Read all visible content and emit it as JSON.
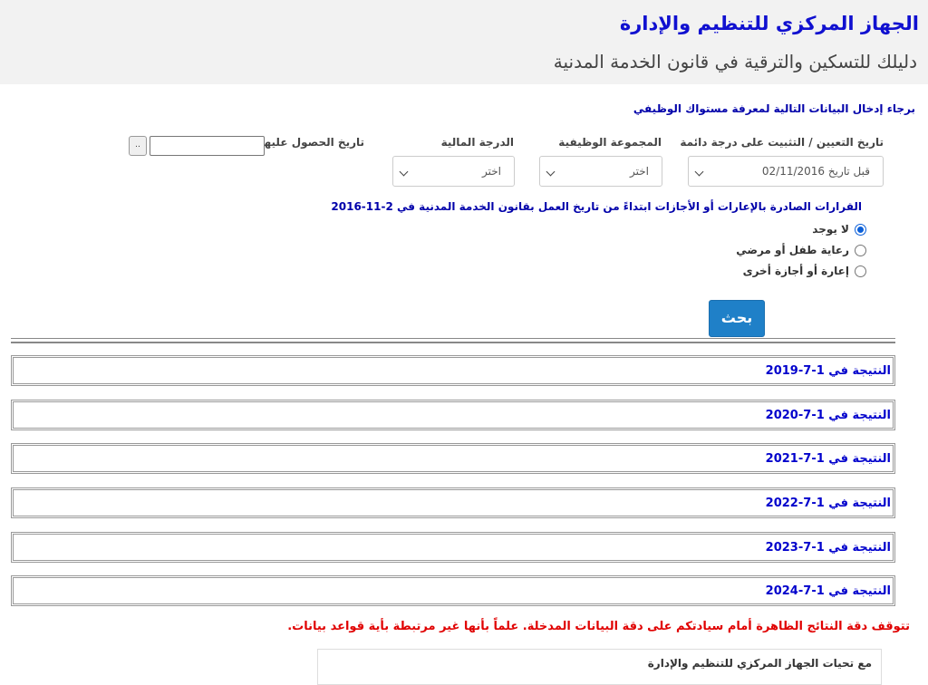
{
  "header": {
    "org_title": "الجهاز المركزي للتنظيم والإدارة",
    "guide_title": "دليلك للتسكين والترقية في قانون الخدمة المدنية"
  },
  "form": {
    "instructions": "برجاء إدخال البيانات التالية لمعرفة مستواك الوظيفي",
    "appointment_label": "تاريخ التعيين / التثبيت على درجة دائمة",
    "appointment_value": "قبل تاريخ 02/11/2016",
    "group_label": "المجموعة الوظيفية",
    "group_value": "اختر",
    "grade_label": "الدرجة المالية",
    "grade_value": "اختر",
    "obtained_label": "تاريخ الحصول عليها",
    "obtained_value": "",
    "dots_label": ".."
  },
  "decisions": {
    "title": "القرارات الصادرة بالإعارات أو الأجازات ابتداءً من تاريخ العمل بقانون الخدمة المدنية في 2-11-2016",
    "options": [
      {
        "label": "لا يوجد",
        "checked": true
      },
      {
        "label": "رعاية طفل أو مرضي",
        "checked": false
      },
      {
        "label": "إعارة أو أجازة أخرى",
        "checked": false
      }
    ]
  },
  "search_label": "بحث",
  "results": [
    "النتيجة في 1-7-2019",
    "النتيجة في 1-7-2020",
    "النتيجة في 1-7-2021",
    "النتيجة في 1-7-2022",
    "النتيجة في 1-7-2023",
    "النتيجة في 1-7-2024"
  ],
  "disclaimer": "تتوقف دقة النتائج الظاهرة أمام سيادتكم على دقة البيانات المدخلة. علماً بأنها غير مرتبطة بأية قواعد بيانات.",
  "regards": "مع تحيات الجهاز المركزي للتنظيم والإدارة"
}
